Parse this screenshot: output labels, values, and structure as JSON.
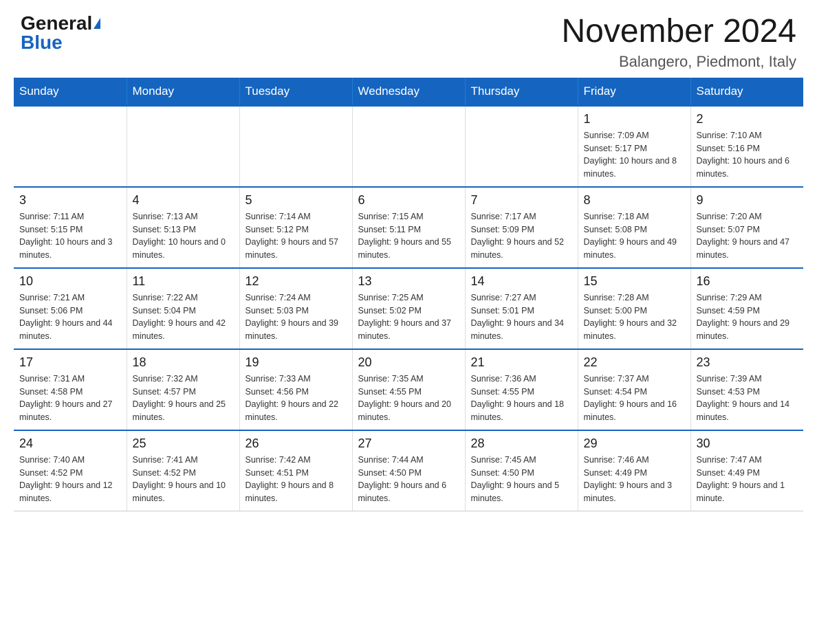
{
  "header": {
    "logo_general": "General",
    "logo_blue": "Blue",
    "title": "November 2024",
    "subtitle": "Balangero, Piedmont, Italy"
  },
  "days_of_week": [
    "Sunday",
    "Monday",
    "Tuesday",
    "Wednesday",
    "Thursday",
    "Friday",
    "Saturday"
  ],
  "weeks": [
    [
      {
        "day": "",
        "info": ""
      },
      {
        "day": "",
        "info": ""
      },
      {
        "day": "",
        "info": ""
      },
      {
        "day": "",
        "info": ""
      },
      {
        "day": "",
        "info": ""
      },
      {
        "day": "1",
        "info": "Sunrise: 7:09 AM\nSunset: 5:17 PM\nDaylight: 10 hours and 8 minutes."
      },
      {
        "day": "2",
        "info": "Sunrise: 7:10 AM\nSunset: 5:16 PM\nDaylight: 10 hours and 6 minutes."
      }
    ],
    [
      {
        "day": "3",
        "info": "Sunrise: 7:11 AM\nSunset: 5:15 PM\nDaylight: 10 hours and 3 minutes."
      },
      {
        "day": "4",
        "info": "Sunrise: 7:13 AM\nSunset: 5:13 PM\nDaylight: 10 hours and 0 minutes."
      },
      {
        "day": "5",
        "info": "Sunrise: 7:14 AM\nSunset: 5:12 PM\nDaylight: 9 hours and 57 minutes."
      },
      {
        "day": "6",
        "info": "Sunrise: 7:15 AM\nSunset: 5:11 PM\nDaylight: 9 hours and 55 minutes."
      },
      {
        "day": "7",
        "info": "Sunrise: 7:17 AM\nSunset: 5:09 PM\nDaylight: 9 hours and 52 minutes."
      },
      {
        "day": "8",
        "info": "Sunrise: 7:18 AM\nSunset: 5:08 PM\nDaylight: 9 hours and 49 minutes."
      },
      {
        "day": "9",
        "info": "Sunrise: 7:20 AM\nSunset: 5:07 PM\nDaylight: 9 hours and 47 minutes."
      }
    ],
    [
      {
        "day": "10",
        "info": "Sunrise: 7:21 AM\nSunset: 5:06 PM\nDaylight: 9 hours and 44 minutes."
      },
      {
        "day": "11",
        "info": "Sunrise: 7:22 AM\nSunset: 5:04 PM\nDaylight: 9 hours and 42 minutes."
      },
      {
        "day": "12",
        "info": "Sunrise: 7:24 AM\nSunset: 5:03 PM\nDaylight: 9 hours and 39 minutes."
      },
      {
        "day": "13",
        "info": "Sunrise: 7:25 AM\nSunset: 5:02 PM\nDaylight: 9 hours and 37 minutes."
      },
      {
        "day": "14",
        "info": "Sunrise: 7:27 AM\nSunset: 5:01 PM\nDaylight: 9 hours and 34 minutes."
      },
      {
        "day": "15",
        "info": "Sunrise: 7:28 AM\nSunset: 5:00 PM\nDaylight: 9 hours and 32 minutes."
      },
      {
        "day": "16",
        "info": "Sunrise: 7:29 AM\nSunset: 4:59 PM\nDaylight: 9 hours and 29 minutes."
      }
    ],
    [
      {
        "day": "17",
        "info": "Sunrise: 7:31 AM\nSunset: 4:58 PM\nDaylight: 9 hours and 27 minutes."
      },
      {
        "day": "18",
        "info": "Sunrise: 7:32 AM\nSunset: 4:57 PM\nDaylight: 9 hours and 25 minutes."
      },
      {
        "day": "19",
        "info": "Sunrise: 7:33 AM\nSunset: 4:56 PM\nDaylight: 9 hours and 22 minutes."
      },
      {
        "day": "20",
        "info": "Sunrise: 7:35 AM\nSunset: 4:55 PM\nDaylight: 9 hours and 20 minutes."
      },
      {
        "day": "21",
        "info": "Sunrise: 7:36 AM\nSunset: 4:55 PM\nDaylight: 9 hours and 18 minutes."
      },
      {
        "day": "22",
        "info": "Sunrise: 7:37 AM\nSunset: 4:54 PM\nDaylight: 9 hours and 16 minutes."
      },
      {
        "day": "23",
        "info": "Sunrise: 7:39 AM\nSunset: 4:53 PM\nDaylight: 9 hours and 14 minutes."
      }
    ],
    [
      {
        "day": "24",
        "info": "Sunrise: 7:40 AM\nSunset: 4:52 PM\nDaylight: 9 hours and 12 minutes."
      },
      {
        "day": "25",
        "info": "Sunrise: 7:41 AM\nSunset: 4:52 PM\nDaylight: 9 hours and 10 minutes."
      },
      {
        "day": "26",
        "info": "Sunrise: 7:42 AM\nSunset: 4:51 PM\nDaylight: 9 hours and 8 minutes."
      },
      {
        "day": "27",
        "info": "Sunrise: 7:44 AM\nSunset: 4:50 PM\nDaylight: 9 hours and 6 minutes."
      },
      {
        "day": "28",
        "info": "Sunrise: 7:45 AM\nSunset: 4:50 PM\nDaylight: 9 hours and 5 minutes."
      },
      {
        "day": "29",
        "info": "Sunrise: 7:46 AM\nSunset: 4:49 PM\nDaylight: 9 hours and 3 minutes."
      },
      {
        "day": "30",
        "info": "Sunrise: 7:47 AM\nSunset: 4:49 PM\nDaylight: 9 hours and 1 minute."
      }
    ]
  ],
  "colors": {
    "header_bg": "#1565c0",
    "header_text": "#ffffff",
    "border": "#1565c0"
  }
}
